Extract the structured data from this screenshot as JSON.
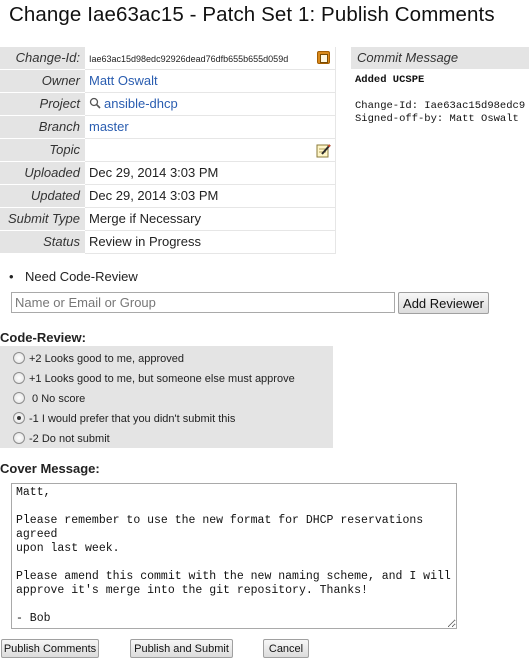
{
  "page": {
    "title": "Change Iae63ac15 - Patch Set 1: Publish Comments"
  },
  "info": {
    "rows": [
      {
        "label": "Change-Id:",
        "value": "Iae63ac15d98edc92926dead76dfb655b655d059d"
      },
      {
        "label": "Owner",
        "value": "Matt Oswalt"
      },
      {
        "label": "Project",
        "value": "ansible-dhcp"
      },
      {
        "label": "Branch",
        "value": "master"
      },
      {
        "label": "Topic",
        "value": ""
      },
      {
        "label": "Uploaded",
        "value": "Dec 29, 2014 3:03 PM"
      },
      {
        "label": "Updated",
        "value": "Dec 29, 2014 3:03 PM"
      },
      {
        "label": "Submit Type",
        "value": "Merge if Necessary"
      },
      {
        "label": "Status",
        "value": "Review in Progress"
      }
    ],
    "icons": {
      "copy": "copy-clipboard-icon",
      "search": "search-icon",
      "edit": "edit-pencil-icon"
    }
  },
  "commit": {
    "header": "Commit Message",
    "subject": "Added UCSPE",
    "change_id_line": "Change-Id: Iae63ac15d98edc9",
    "signed_off_line": "Signed-off-by: Matt Oswalt"
  },
  "reviewers": {
    "need_label": "Need Code-Review",
    "input_placeholder": "Name or Email or Group",
    "add_button": "Add Reviewer"
  },
  "code_review": {
    "label": "Code-Review:",
    "options": [
      {
        "text": "+2 Looks good to me, approved",
        "checked": false
      },
      {
        "text": "+1 Looks good to me, but someone else must approve",
        "checked": false
      },
      {
        "text": " 0 No score",
        "checked": false
      },
      {
        "text": "-1 I would prefer that you didn't submit this",
        "checked": true
      },
      {
        "text": "-2 Do not submit",
        "checked": false
      }
    ]
  },
  "cover": {
    "label": "Cover Message:",
    "text": "Matt,\n\nPlease remember to use the new format for DHCP reservations agreed\nupon last week.\n\nPlease amend this commit with the new naming scheme, and I will\napprove it's merge into the git repository. Thanks!\n\n- Bob"
  },
  "actions": {
    "publish": "Publish Comments",
    "publish_submit": "Publish and Submit",
    "cancel": "Cancel"
  },
  "colors": {
    "label_bg": "#e4e4e4",
    "link": "#2a5db0"
  }
}
